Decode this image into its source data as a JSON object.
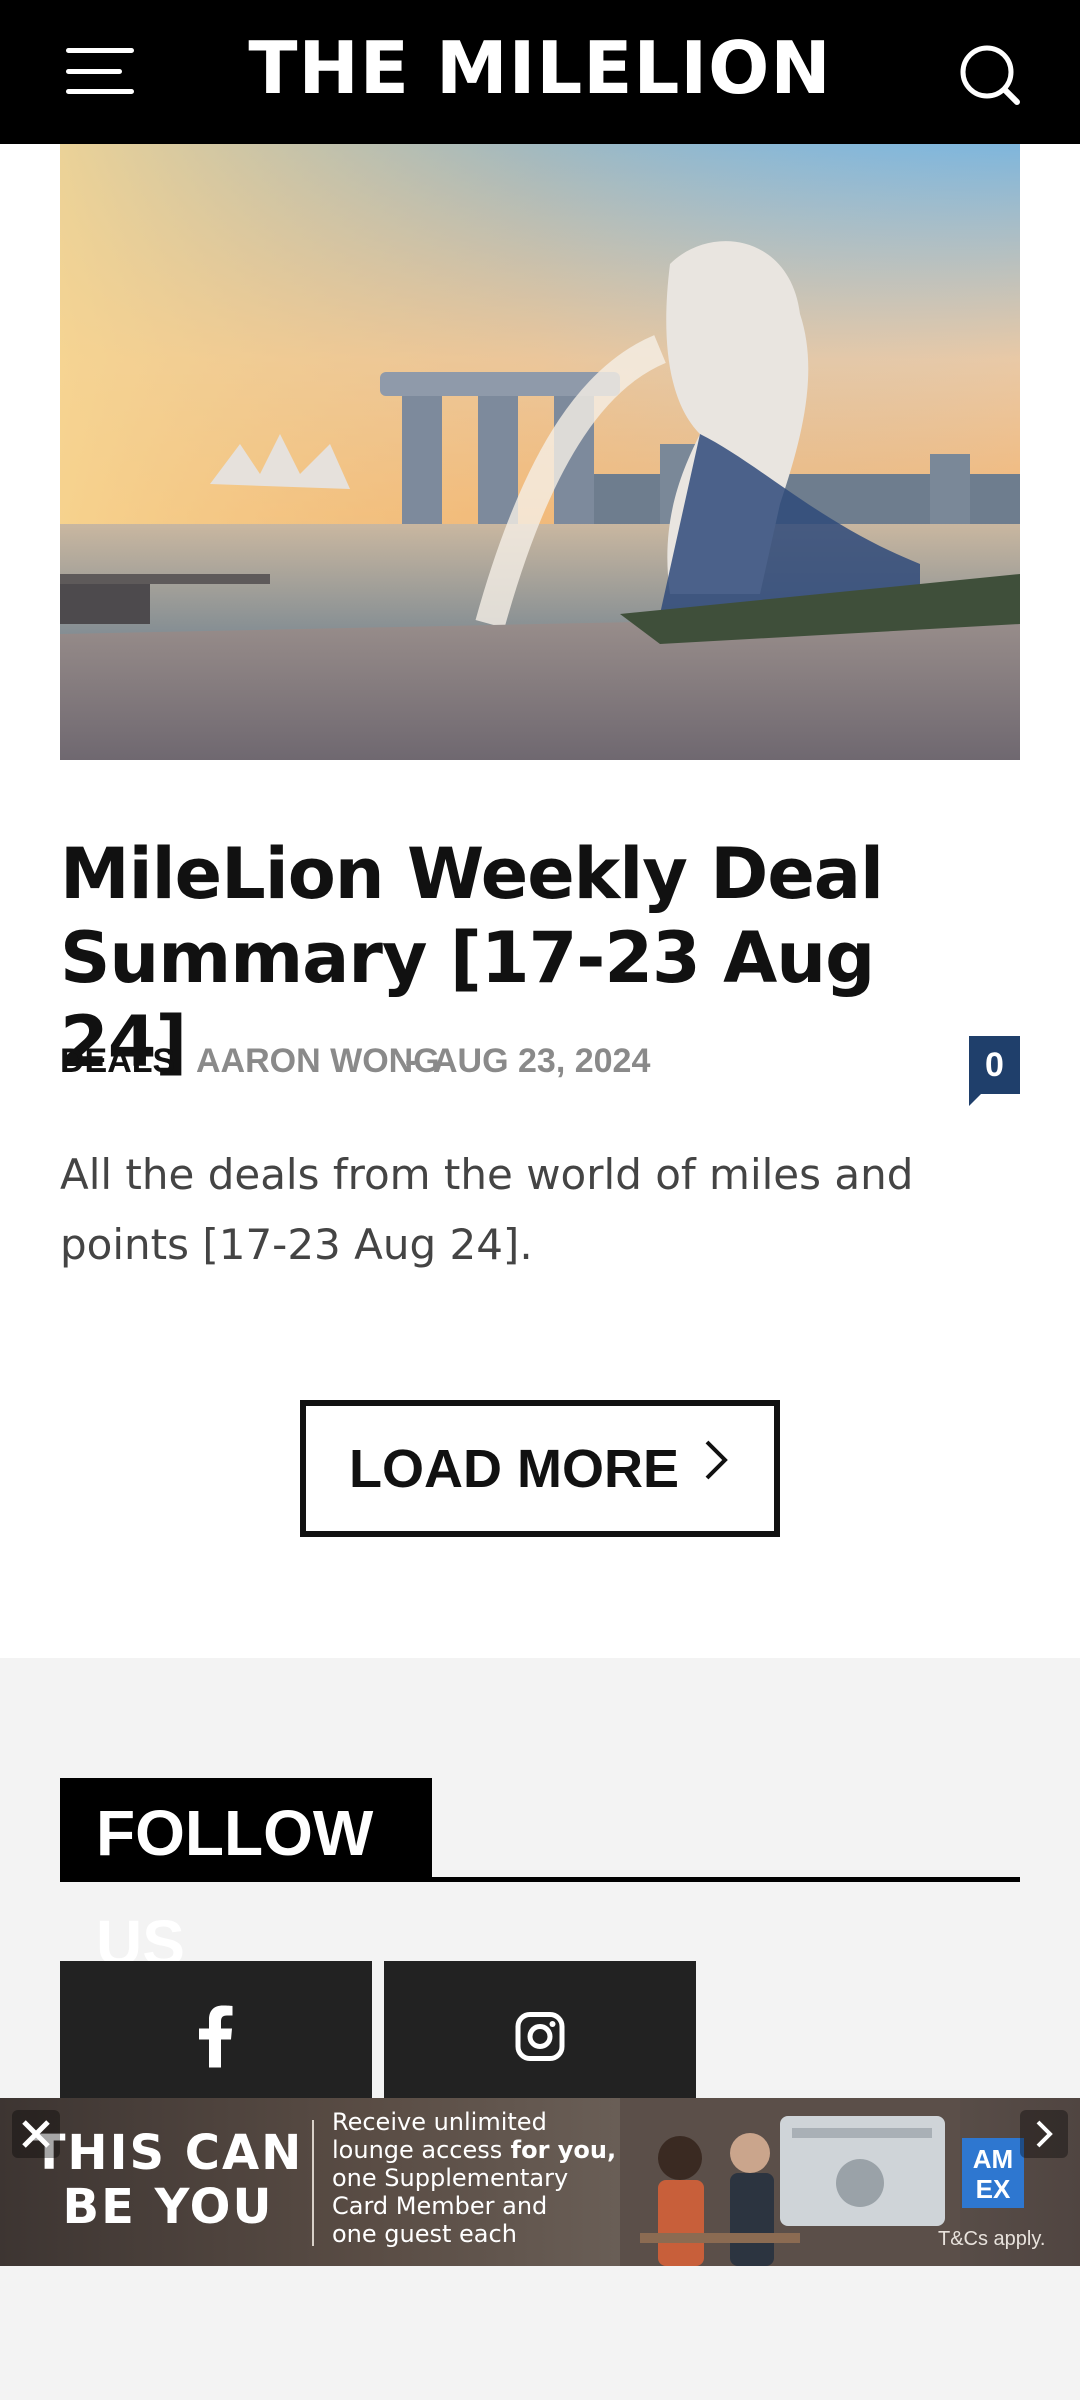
{
  "header": {
    "site_title": "THE MILELION",
    "menu_icon": "hamburger-menu-icon",
    "search_icon": "search-icon",
    "background_color": "#000000"
  },
  "article": {
    "image_description_icon": "merlion-singapore-photo",
    "title": "MileLion Weekly Deal Summary [17-23 Aug 24]",
    "category": "DEALS",
    "author": "AARON WONG",
    "separator": "-",
    "date": "AUG 23, 2024",
    "comment_count": "0",
    "excerpt": "All the deals from the world of miles and points [17-23 Aug 24].",
    "badge_color": "#1f3f6b"
  },
  "pagination": {
    "load_more_label": "LOAD MORE"
  },
  "follow": {
    "heading": "FOLLOW US",
    "socials": [
      {
        "icon": "facebook-icon"
      },
      {
        "icon": "instagram-icon"
      }
    ]
  },
  "ad": {
    "headline": "THIS CAN BE YOU",
    "copy_line1": "Receive unlimited",
    "copy_line2": "lounge access",
    "copy_line2b": " for you,",
    "copy_line3": "one Supplementary",
    "copy_line4": "Card Member and",
    "copy_line5": "one guest each",
    "brand": "AM EX",
    "terms": "T&Cs apply."
  }
}
